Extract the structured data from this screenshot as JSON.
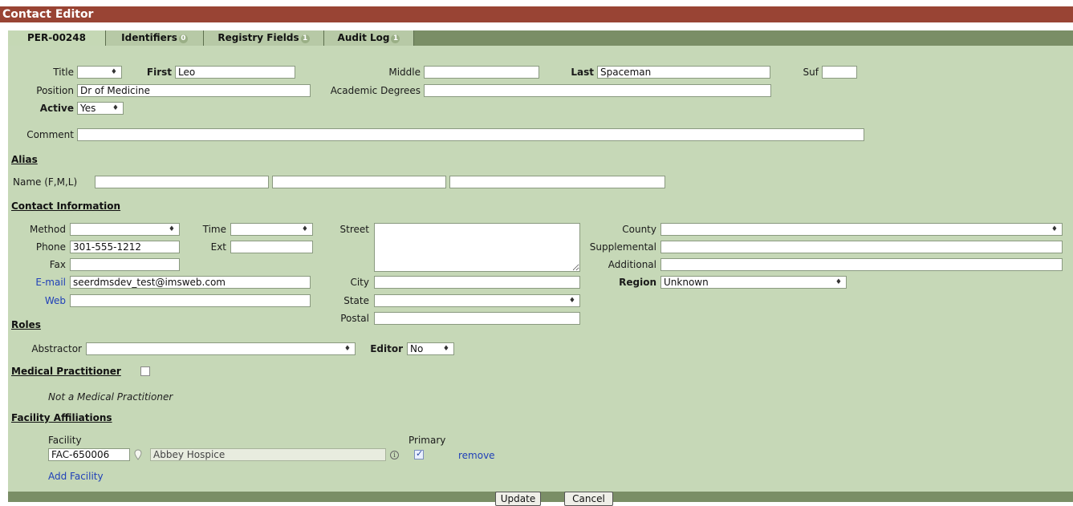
{
  "window": {
    "title": "Contact Editor"
  },
  "tabs": [
    {
      "label": "PER-00248",
      "badge": ""
    },
    {
      "label": "Identifiers",
      "badge": "0"
    },
    {
      "label": "Registry Fields",
      "badge": "1"
    },
    {
      "label": "Audit Log",
      "badge": "1"
    }
  ],
  "person": {
    "title_label": "Title",
    "title_value": "",
    "first_label": "First",
    "first_value": "Leo",
    "middle_label": "Middle",
    "middle_value": "",
    "last_label": "Last",
    "last_value": "Spaceman",
    "suffix_label": "Suf",
    "suffix_value": "",
    "position_label": "Position",
    "position_value": "Dr of Medicine",
    "degrees_label": "Academic Degrees",
    "degrees_value": "",
    "active_label": "Active",
    "active_value": "Yes",
    "comment_label": "Comment",
    "comment_value": ""
  },
  "alias": {
    "header": "Alias",
    "name_label": "Name (F,M,L)",
    "first": "",
    "middle": "",
    "last": ""
  },
  "contact": {
    "header": "Contact Information",
    "method_label": "Method",
    "method_value": "",
    "time_label": "Time",
    "time_value": "",
    "phone_label": "Phone",
    "phone_value": "301-555-1212",
    "ext_label": "Ext",
    "ext_value": "",
    "fax_label": "Fax",
    "fax_value": "",
    "email_label": "E-mail",
    "email_value": "seerdmsdev_test@imsweb.com",
    "web_label": "Web",
    "web_value": "",
    "street_label": "Street",
    "street_value": "",
    "city_label": "City",
    "city_value": "",
    "state_label": "State",
    "state_value": "",
    "postal_label": "Postal",
    "postal_value": "",
    "county_label": "County",
    "county_value": "",
    "supplemental_label": "Supplemental",
    "supplemental_value": "",
    "additional_label": "Additional",
    "additional_value": "",
    "region_label": "Region",
    "region_value": "Unknown"
  },
  "roles": {
    "header": "Roles",
    "abstractor_label": "Abstractor",
    "abstractor_value": "",
    "editor_label": "Editor",
    "editor_value": "No"
  },
  "medical": {
    "header": "Medical Practitioner",
    "checked": false,
    "status_text": "Not a Medical Practitioner"
  },
  "facility": {
    "header": "Facility Affiliations",
    "facility_col": "Facility",
    "primary_col": "Primary",
    "rows": [
      {
        "code": "FAC-650006",
        "name": "Abbey Hospice",
        "primary": true,
        "remove_label": "remove"
      }
    ],
    "add_label": "Add Facility"
  },
  "actions": {
    "update_label": "Update",
    "cancel_label": "Cancel"
  },
  "colors": {
    "title_bar": "#994434",
    "panel": "#c6d8b7",
    "tab_strip": "#7a8e66",
    "link": "#1f3fb8"
  },
  "icons": [
    "sort-arrows-icon",
    "location-pin-icon",
    "info-icon",
    "checkbox-icon"
  ]
}
